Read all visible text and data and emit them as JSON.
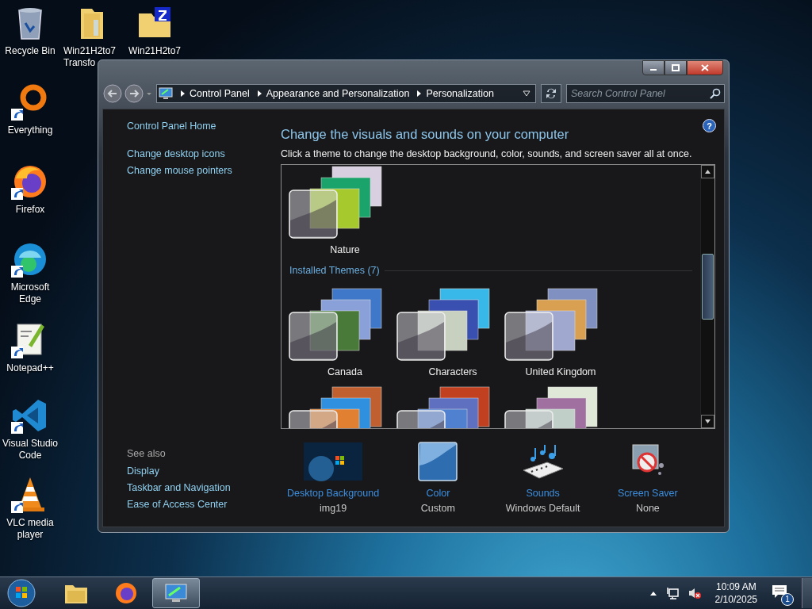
{
  "desktop_icons": [
    {
      "label": "Recycle Bin",
      "kind": "recycle-bin",
      "shortcut": false
    },
    {
      "label": "Win21H2to7 Transfo",
      "kind": "folder",
      "shortcut": false
    },
    {
      "label": "Win21H2to7",
      "kind": "zip-folder",
      "shortcut": false
    },
    {
      "label": "Everything",
      "kind": "everything",
      "shortcut": true
    },
    {
      "label": "Firefox",
      "kind": "firefox",
      "shortcut": true
    },
    {
      "label": "Microsoft Edge",
      "kind": "edge",
      "shortcut": true
    },
    {
      "label": "Notepad++",
      "kind": "notepad",
      "shortcut": true
    },
    {
      "label": "Visual Studio Code",
      "kind": "vscode",
      "shortcut": true
    },
    {
      "label": "VLC media player",
      "kind": "vlc",
      "shortcut": true
    }
  ],
  "window": {
    "breadcrumb": [
      "Control Panel",
      "Appearance and Personalization",
      "Personalization"
    ],
    "search": {
      "placeholder": "Search Control Panel"
    },
    "help": "?",
    "sidebar": {
      "links": [
        "Control Panel Home",
        "Change desktop icons",
        "Change mouse pointers"
      ],
      "see_also_title": "See also",
      "see_also": [
        "Display",
        "Taskbar and Navigation",
        "Ease of Access Center"
      ]
    },
    "heading": "Change the visuals and sounds on your computer",
    "description": "Click a theme to change the desktop background, color, sounds, and screen saver all at once.",
    "themes": [
      {
        "name": "Nature",
        "kind": "nature"
      }
    ],
    "sections": [
      {
        "title": "Installed Themes (7)",
        "themes": [
          {
            "name": "Canada",
            "kind": "canada"
          },
          {
            "name": "Characters",
            "kind": "characters"
          },
          {
            "name": "United Kingdom",
            "kind": "uk"
          },
          {
            "kind": "sunset"
          },
          {
            "kind": "architecture"
          },
          {
            "kind": "scenes"
          }
        ]
      }
    ],
    "settings": [
      {
        "label": "Desktop Background",
        "value": "img19",
        "kind": "background"
      },
      {
        "label": "Color",
        "value": "Custom",
        "kind": "color"
      },
      {
        "label": "Sounds",
        "value": "Windows Default",
        "kind": "sounds"
      },
      {
        "label": "Screen Saver",
        "value": "None",
        "kind": "screensaver"
      }
    ]
  },
  "taskbar": {
    "apps": [
      {
        "kind": "explorer",
        "selected": false
      },
      {
        "kind": "firefox",
        "selected": false
      },
      {
        "kind": "control-panel",
        "selected": true
      }
    ],
    "clock": {
      "time": "10:09 AM",
      "date": "2/10/2025"
    },
    "notification_count": "1"
  }
}
